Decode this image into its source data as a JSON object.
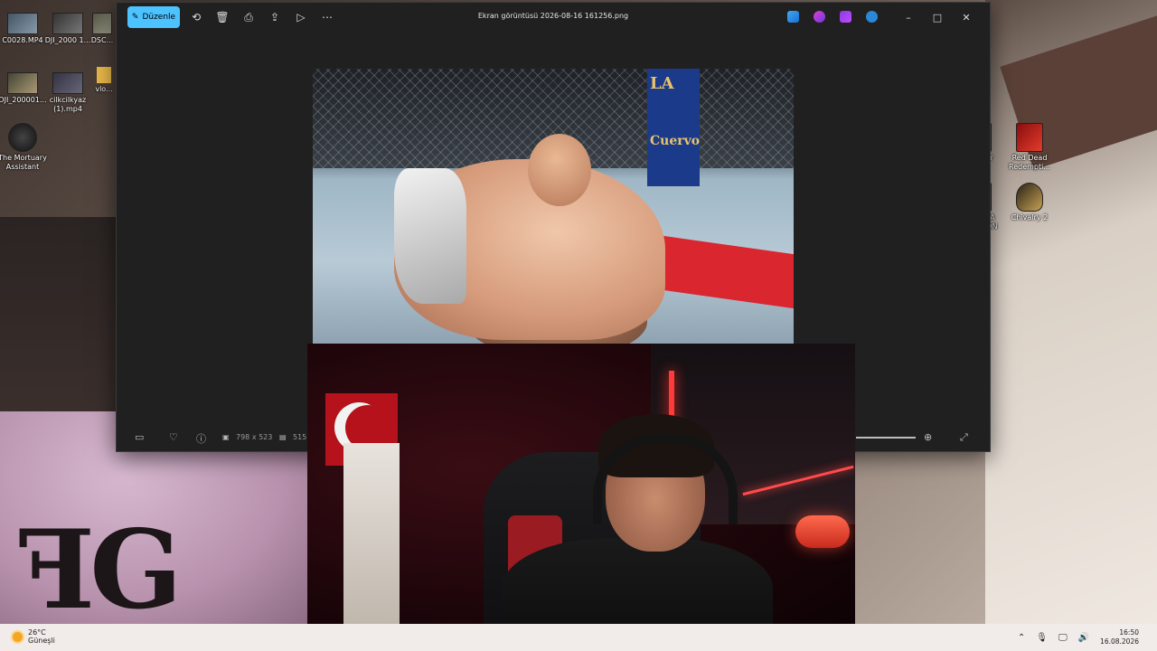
{
  "desktop": {
    "icons": [
      {
        "label": "C0028.MP4"
      },
      {
        "label": "DJI_2000 1..."
      },
      {
        "label": "DSC..."
      },
      {
        "label": "DJI_200001..."
      },
      {
        "label": "cilkcilkyaz (1).mp4"
      },
      {
        "label": "vlo..."
      },
      {
        "label": "The Mortuary Assistant"
      },
      {
        "label": "Red Dead Redempti..."
      },
      {
        "label": "Chivalry 2"
      },
      {
        "label": "...er"
      },
      {
        "label": "...HA ...EON"
      }
    ]
  },
  "photos": {
    "edit_label": "Düzenle",
    "title": "Ekran görüntüsü 2026-08-16 161256.png",
    "toolbar_icons": [
      "rotate-icon",
      "delete-icon",
      "print-icon",
      "share-icon",
      "slideshow-icon",
      "more-icon"
    ],
    "caption": {
      "minimize": "–",
      "maximize": "□",
      "close": "✕"
    },
    "bottom": {
      "dimensions": "798 x 523",
      "size_partial": "515"
    }
  },
  "photo_text": {
    "pad_text": "Cuervo",
    "cage_text": "LA"
  },
  "taskbar": {
    "temperature": "26°C",
    "condition": "Güneşli",
    "time": "16:50",
    "date": "16.08.2026"
  },
  "colors": {
    "accent": "#4cc2ff",
    "window_bg": "#202020",
    "taskbar_bg": "#f1ecea"
  }
}
